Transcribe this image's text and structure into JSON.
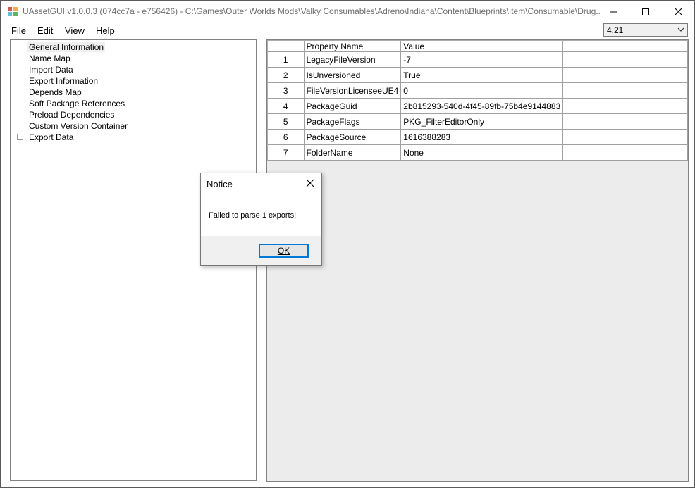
{
  "window": {
    "title": "UAssetGUI v1.0.0.3 (074cc7a - e756426) - C:\\Games\\Outer Worlds Mods\\Valky Consumables\\Adreno\\Indiana\\Content\\Blueprints\\Item\\Consumable\\Drug..."
  },
  "menu": {
    "items": [
      {
        "label": "File"
      },
      {
        "label": "Edit"
      },
      {
        "label": "View"
      },
      {
        "label": "Help"
      }
    ]
  },
  "version_select": {
    "value": "4.21"
  },
  "tree": {
    "items": [
      {
        "label": "General Information",
        "selected": true
      },
      {
        "label": "Name Map"
      },
      {
        "label": "Import Data"
      },
      {
        "label": "Export Information"
      },
      {
        "label": "Depends Map"
      },
      {
        "label": "Soft Package References"
      },
      {
        "label": "Preload Dependencies"
      },
      {
        "label": "Custom Version Container"
      },
      {
        "label": "Export Data",
        "expandable": true
      }
    ]
  },
  "grid": {
    "columns": [
      "",
      "Property Name",
      "Value",
      ""
    ],
    "rows": [
      {
        "index": "1",
        "name": "LegacyFileVersion",
        "value": "-7"
      },
      {
        "index": "2",
        "name": "IsUnversioned",
        "value": "True"
      },
      {
        "index": "3",
        "name": "FileVersionLicenseeUE4",
        "value": "0"
      },
      {
        "index": "4",
        "name": "PackageGuid",
        "value": "2b815293-540d-4f45-89fb-75b4e9144883"
      },
      {
        "index": "5",
        "name": "PackageFlags",
        "value": "PKG_FilterEditorOnly"
      },
      {
        "index": "6",
        "name": "PackageSource",
        "value": "1616388283"
      },
      {
        "index": "7",
        "name": "FolderName",
        "value": "None"
      }
    ]
  },
  "dialog": {
    "title": "Notice",
    "message": "Failed to parse 1 exports!",
    "ok_label": "OK"
  },
  "icons": {
    "app": "app-icon",
    "minimize": "minimize-icon",
    "maximize": "maximize-icon",
    "close": "close-icon",
    "dropdown": "chevron-down-icon",
    "expand": "plus-expander-icon"
  }
}
